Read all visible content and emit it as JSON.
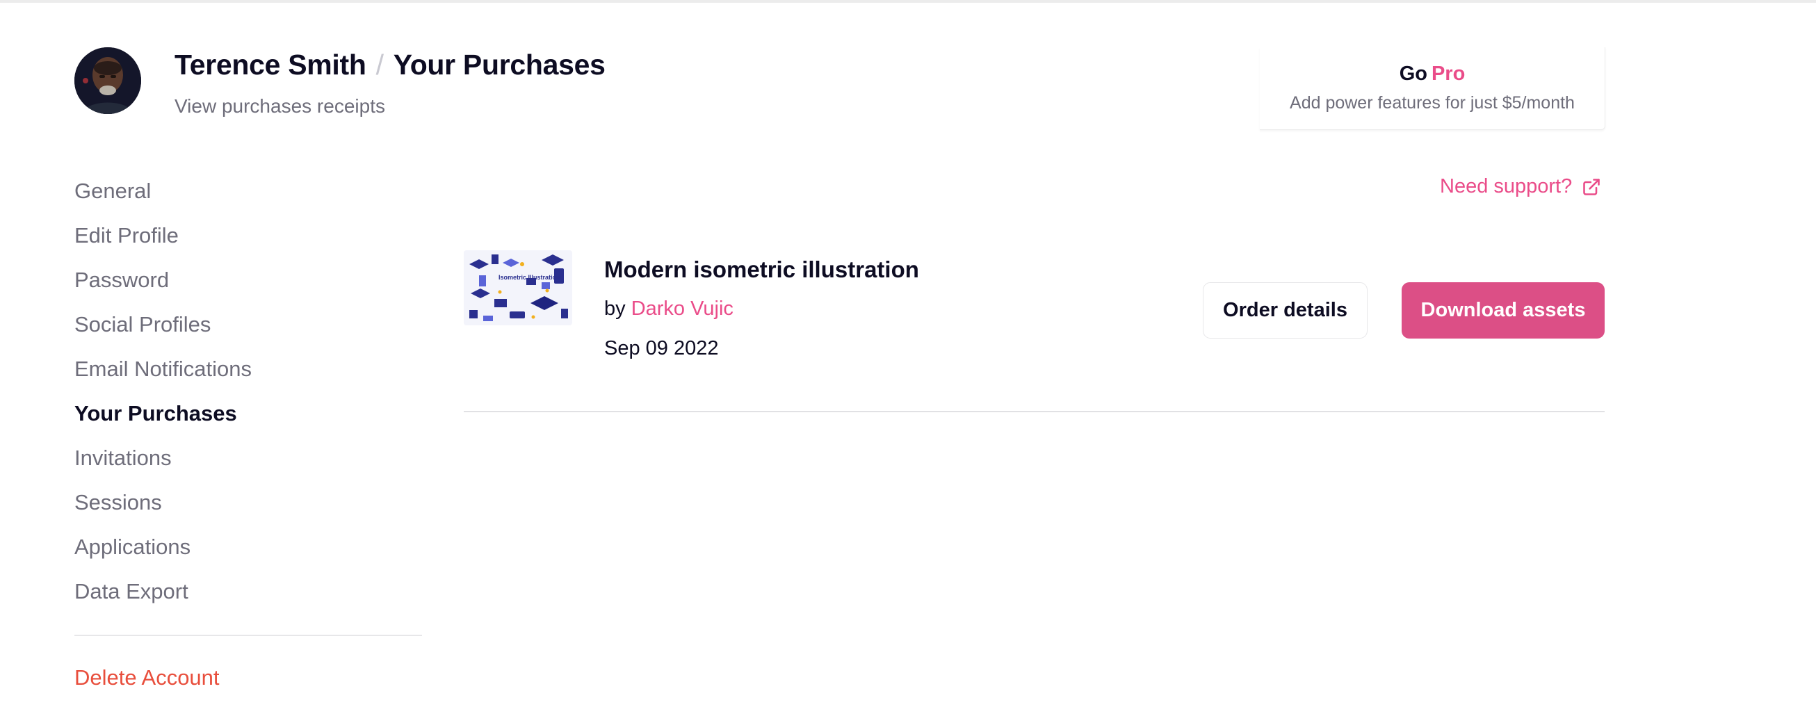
{
  "header": {
    "user_name": "Terence Smith",
    "separator": "/",
    "page_name": "Your Purchases",
    "subtitle": "View purchases receipts"
  },
  "pro_card": {
    "go": "Go",
    "pro": "Pro",
    "description": "Add power features for just $5/month"
  },
  "sidebar": {
    "items": [
      {
        "label": "General",
        "active": false
      },
      {
        "label": "Edit Profile",
        "active": false
      },
      {
        "label": "Password",
        "active": false
      },
      {
        "label": "Social Profiles",
        "active": false
      },
      {
        "label": "Email Notifications",
        "active": false
      },
      {
        "label": "Your Purchases",
        "active": true
      },
      {
        "label": "Invitations",
        "active": false
      },
      {
        "label": "Sessions",
        "active": false
      },
      {
        "label": "Applications",
        "active": false
      },
      {
        "label": "Data Export",
        "active": false
      }
    ],
    "delete_account": "Delete Account"
  },
  "support": {
    "label": "Need support?",
    "icon": "external-link-icon"
  },
  "purchases": [
    {
      "title": "Modern isometric illustration",
      "by_prefix": "by",
      "author": "Darko Vujic",
      "date": "Sep 09 2022",
      "thumbnail_text": "Isometric Illustrations",
      "order_details_label": "Order details",
      "download_label": "Download assets"
    }
  ],
  "colors": {
    "accent": "#ea4c89",
    "button_accent": "#dc4f86",
    "danger": "#e84e3c",
    "text_primary": "#0d0c22",
    "text_secondary": "#6e6d7a"
  }
}
